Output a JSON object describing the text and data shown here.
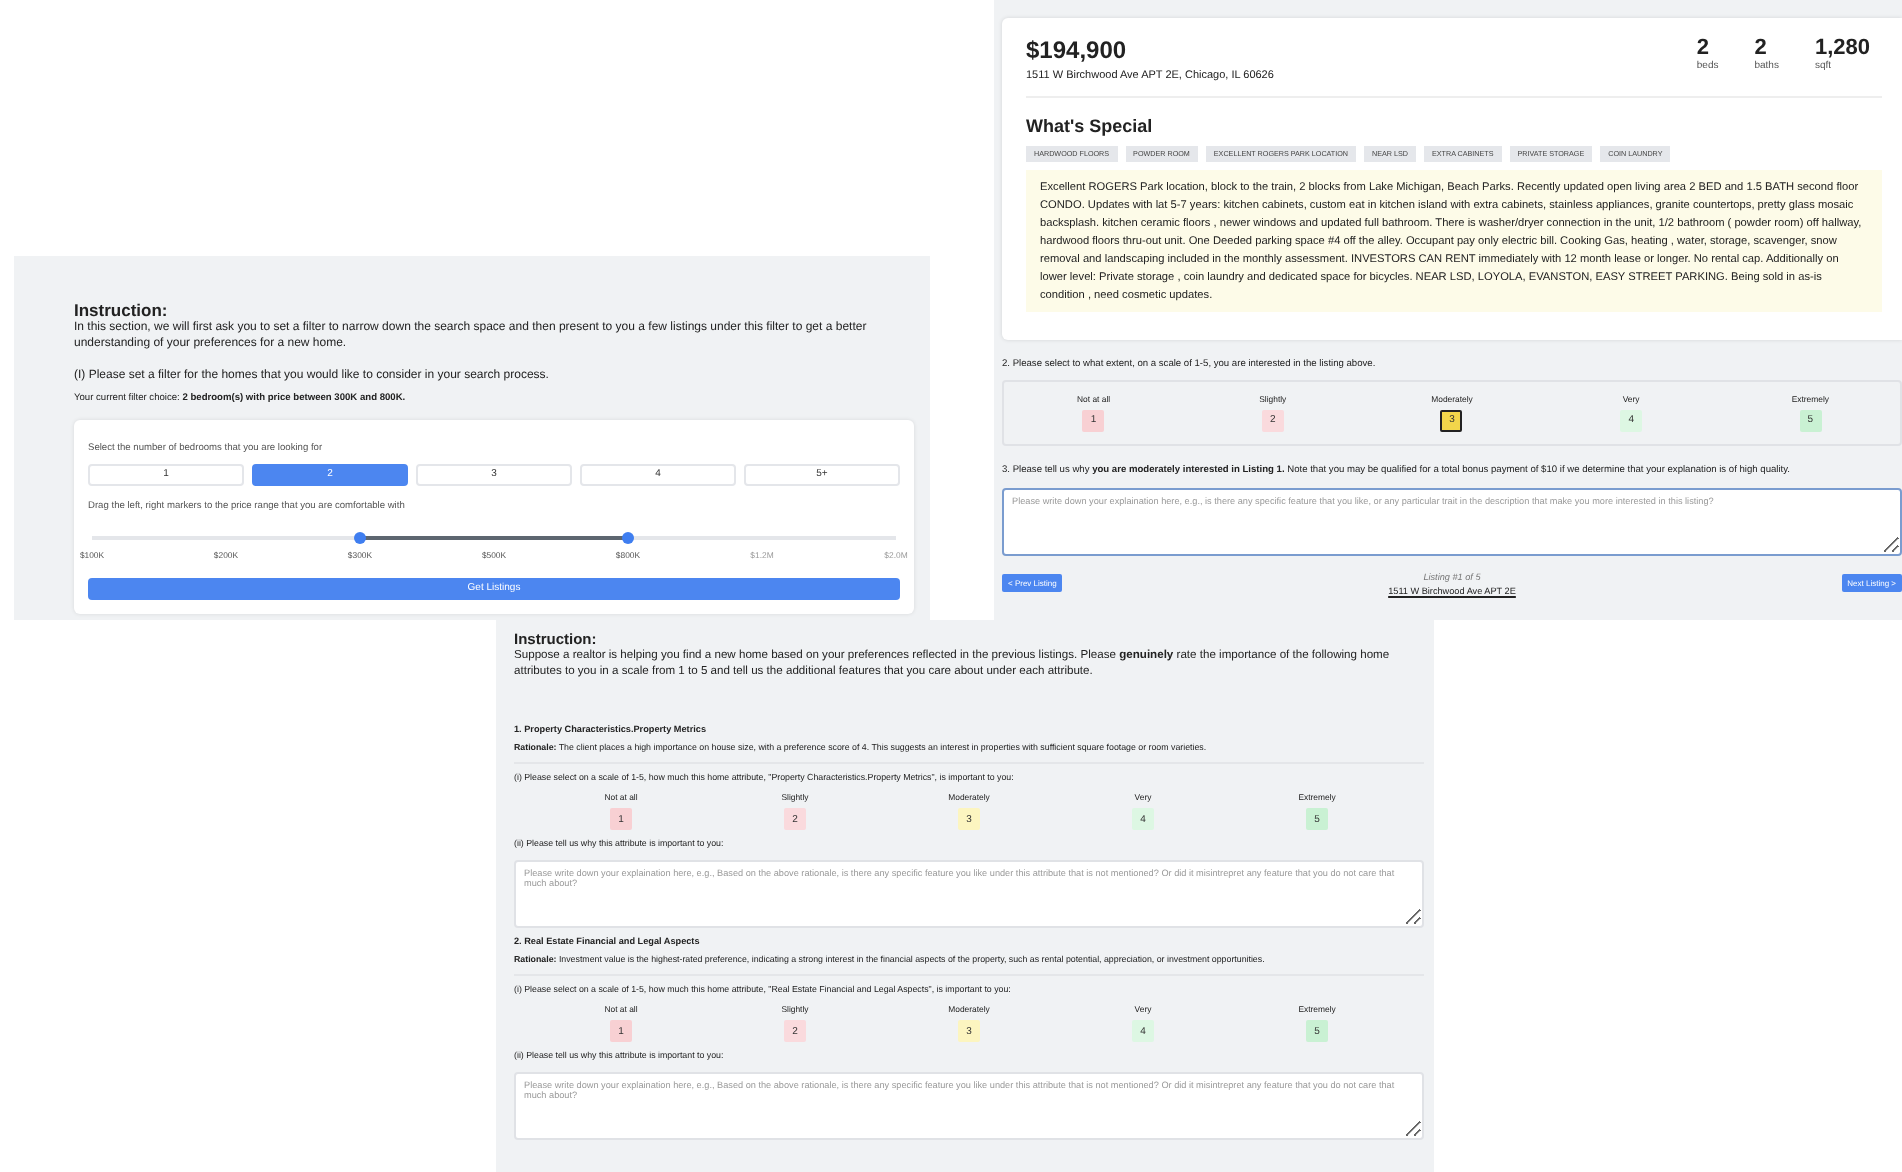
{
  "filter_panel": {
    "instruction_heading": "Instruction:",
    "instruction_text": "In this section, we will first ask you to set a filter to narrow down the search space and then present to you a few listings under this filter to get a better understanding of your preferences for a new home.",
    "question": "(I) Please set a filter for the homes that you would like to consider in your search process.",
    "current_choice": "Your current filter choice: **2 bedroom(s) with price between 300K and 800K.**",
    "bedroom_label": "Select the number of bedrooms that you are looking for",
    "bedroom_options": [
      {
        "label": "1",
        "selected": false
      },
      {
        "label": "2",
        "selected": true
      },
      {
        "label": "3",
        "selected": false
      },
      {
        "label": "4",
        "selected": false
      },
      {
        "label": "5+",
        "selected": false
      }
    ],
    "price_label": "Drag the left, right markers to the price range that you are comfortable with",
    "price_ticks": [
      "$100K",
      "$200K",
      "$300K",
      "$500K",
      "$800K",
      "$1.2M",
      "$2.0M"
    ],
    "range_low": {
      "level": 0.333
    },
    "range_high": {
      "level": 0.667
    },
    "button": "Get Listings"
  },
  "listing_panel": {
    "price": "$194,900",
    "address": "1511 W Birchwood Ave APT 2E, Chicago, IL 60626",
    "stats": [
      {
        "value": "2",
        "unit": "beds"
      },
      {
        "value": "2",
        "unit": "baths"
      },
      {
        "value": "1,280",
        "unit": "sqft"
      }
    ],
    "special_heading": "What's Special",
    "tags": [
      "HARDWOOD FLOORS",
      "POWDER ROOM",
      "EXCELLENT ROGERS PARK LOCATION",
      "NEAR LSD",
      "EXTRA CABINETS",
      "PRIVATE STORAGE",
      "COIN LAUNDRY"
    ],
    "description": "Excellent ROGERS Park location, block to the train, 2 blocks from Lake Michigan, Beach Parks. Recently updated open living area 2 BED and 1.5 BATH second floor CONDO. Updates with lat 5-7 years: kitchen cabinets, custom eat in kitchen island with extra cabinets, stainless appliances, granite countertops, pretty glass mosaic backsplash. kitchen ceramic floors , newer windows and updated full bathroom. There is washer/dryer connection in the unit, 1/2 bathroom ( powder room) off hallway, hardwood floors thru-out unit. One Deeded parking space #4 off the alley. Occupant pay only electric bill. Cooking Gas, heating , water, storage, scavenger, snow removal and landscaping included in the monthly assessment. INVESTORS CAN RENT immediately with 12 month lease or longer. No rental cap. Additionally on lower level: Private storage , coin laundry and dedicated space for bicycles. NEAR LSD, LOYOLA, EVANSTON, EASY STREET PARKING. Being sold in as-is condition , need cosmetic updates.",
    "question_2": "2. Please select to what extent, on a scale of 1-5, you are interested in the listing above.",
    "ratings": [
      {
        "label": "Not at all",
        "value": "1",
        "color": "#f8d0d3",
        "selected": false
      },
      {
        "label": "Slightly",
        "value": "2",
        "color": "#fadadd",
        "selected": false
      },
      {
        "label": "Moderately",
        "value": "3",
        "color": "#f2d64b",
        "selected": true
      },
      {
        "label": "Very",
        "value": "4",
        "color": "#ddf7e3",
        "selected": false
      },
      {
        "label": "Extremely",
        "value": "5",
        "color": "#c9f1d3",
        "selected": false
      }
    ],
    "question_3": "3. Please tell us why **you are moderately interested in Listing 1.** Note that you may be qualified for a total bonus payment of $10 if we determine that your explanation is of high quality.",
    "explanation_placeholder": "Please write down your explaination here, e.g., is there any specific feature that you like, or any particular trait in the description that make you more interested in this listing?",
    "prev_button": "< Prev Listing",
    "counter": "Listing #1 of 5",
    "listing_link": "1511 W Birchwood Ave APT 2E",
    "next_button": "Next Listing >"
  },
  "attributes_panel": {
    "instruction_heading": "Instruction:",
    "instruction_text": "Suppose a realtor is helping you find a new home based on your preferences reflected in the previous listings. Please **genuinely** rate the importance of the following home attributes to you in a scale from 1 to 5 and tell us the additional features that you care about under each attribute.",
    "attributes": [
      {
        "title": "1. Property Characteristics.Property Metrics",
        "rationale": "**Rationale:** The client places a high importance on house size, with a preference score of 4. This suggests an interest in properties with sufficient square footage or room varieties.",
        "scale_question": "(i) Please select on a scale of 1-5, how much this home attribute, \"Property Characteristics.Property Metrics\", is important to you:",
        "ratings": [
          {
            "label": "Not at all",
            "value": "1",
            "color": "#f8d0d3",
            "selected": false
          },
          {
            "label": "Slightly",
            "value": "2",
            "color": "#fadadd",
            "selected": false
          },
          {
            "label": "Moderately",
            "value": "3",
            "color": "#fcf5c0",
            "selected": false
          },
          {
            "label": "Very",
            "value": "4",
            "color": "#ddf7e3",
            "selected": false
          },
          {
            "label": "Extremely",
            "value": "5",
            "color": "#c9f1d3",
            "selected": false
          }
        ],
        "why_question": "(ii) Please tell us why this attribute is important to you:",
        "placeholder": "Please write down your explaination here, e.g., Based on the above rationale, is there any specific feature you like under this attribute that is not mentioned? Or did it misintrepret any feature that you do not care that much about?"
      },
      {
        "title": "2. Real Estate Financial and Legal Aspects",
        "rationale": "**Rationale:** Investment value is the highest-rated preference, indicating a strong interest in the financial aspects of the property, such as rental potential, appreciation, or investment opportunities.",
        "scale_question": "(i) Please select on a scale of 1-5, how much this home attribute, \"Real Estate Financial and Legal Aspects\", is important to you:",
        "ratings": [
          {
            "label": "Not at all",
            "value": "1",
            "color": "#f8d0d3",
            "selected": false
          },
          {
            "label": "Slightly",
            "value": "2",
            "color": "#fadadd",
            "selected": false
          },
          {
            "label": "Moderately",
            "value": "3",
            "color": "#fcf5c0",
            "selected": false
          },
          {
            "label": "Very",
            "value": "4",
            "color": "#ddf7e3",
            "selected": false
          },
          {
            "label": "Extremely",
            "value": "5",
            "color": "#c9f1d3",
            "selected": false
          }
        ],
        "why_question": "(ii) Please tell us why this attribute is important to you:",
        "placeholder": "Please write down your explaination here, e.g., Based on the above rationale, is there any specific feature you like under this attribute that is not mentioned? Or did it misintrepret any feature that you do not care that much about?"
      }
    ]
  }
}
